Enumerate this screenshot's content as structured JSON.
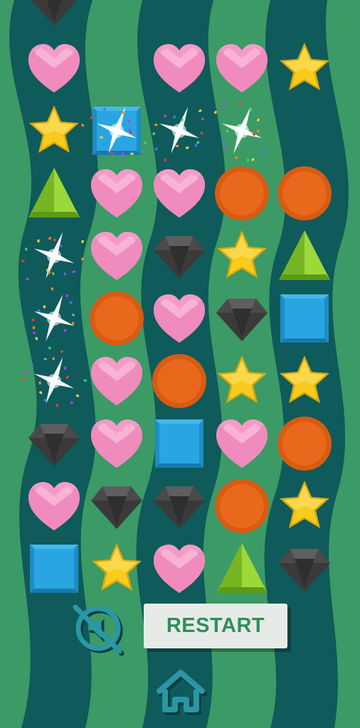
{
  "game": {
    "colors": {
      "bg_dark": "#0f5a5a",
      "bg_light": "#3b9a66",
      "heart": "#f59bc8",
      "star": "#f7cc1e",
      "circle": "#e8681c",
      "triangle": "#8ccc2e",
      "square": "#29a6e2",
      "diamond": "#4a4a4a",
      "button": "#e6ebe8",
      "button_text": "#2f8f5a",
      "icon": "#2a97a4"
    },
    "board": [
      [
        "empty",
        "heart",
        "empty",
        "heart",
        "heart",
        "star"
      ],
      [
        "empty",
        "star",
        "square",
        "empty",
        "empty",
        "empty"
      ],
      [
        "empty",
        "triangle",
        "heart",
        "heart",
        "circle",
        "circle"
      ],
      [
        "empty",
        "empty",
        "heart",
        "diamond",
        "star",
        "triangle"
      ],
      [
        "empty",
        "empty",
        "circle",
        "heart",
        "diamond",
        "square"
      ],
      [
        "empty",
        "empty",
        "heart",
        "circle",
        "star",
        "star"
      ],
      [
        "empty",
        "diamond",
        "heart",
        "square",
        "heart",
        "circle"
      ],
      [
        "empty",
        "heart",
        "diamond",
        "diamond",
        "circle",
        "star"
      ],
      [
        "empty",
        "square",
        "star",
        "heart",
        "triangle",
        "diamond"
      ]
    ],
    "top_partial_piece": "diamond",
    "sparkle_cells": [
      [
        1,
        2
      ],
      [
        1,
        3
      ],
      [
        1,
        4
      ],
      [
        3,
        0
      ],
      [
        4,
        0
      ],
      [
        5,
        0
      ]
    ],
    "restart_label": "RESTART",
    "sound_icon": "sound-off-icon",
    "home_icon": "home-icon"
  }
}
